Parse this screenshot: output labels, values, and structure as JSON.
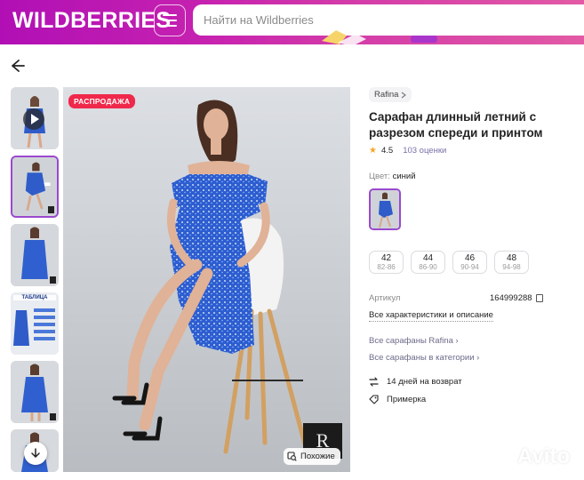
{
  "header": {
    "logo": "WILDBERRIES",
    "search_placeholder": "Найти на Wildberries",
    "gradient_colors": [
      "#b10fb5",
      "#e25aa5"
    ]
  },
  "thumbnails": [
    {
      "kind": "video",
      "icon": "play-icon"
    },
    {
      "kind": "photo",
      "active": true
    },
    {
      "kind": "photo"
    },
    {
      "kind": "size-table",
      "label": "ТАБЛИЦА"
    },
    {
      "kind": "photo"
    },
    {
      "kind": "photo"
    }
  ],
  "main_image": {
    "sale_badge": "РАСПРОДАЖА",
    "brand_mark": "R",
    "similar_label": "Похожие",
    "sale_color": "#f0284b"
  },
  "product": {
    "brand": "Rafina",
    "title": "Сарафан длинный летний с разрезом спереди и принтом",
    "rating": "4.5",
    "reviews": "103 оценки",
    "color_label": "Цвет:",
    "color_value": "синий",
    "sizes": [
      {
        "size": "42",
        "range": "82-86"
      },
      {
        "size": "44",
        "range": "86-90"
      },
      {
        "size": "46",
        "range": "90-94"
      },
      {
        "size": "48",
        "range": "94-98"
      }
    ],
    "article_label": "Артикул",
    "article_value": "164999288",
    "all_specs": "Все характеристики и описание",
    "all_brand": "Все сарафаны Rafina",
    "all_category": "Все сарафаны в категории",
    "return_text": "14 дней на возврат",
    "fitting_text": "Примерка",
    "accent_color": "#9a49ce"
  },
  "watermark": "Avito"
}
